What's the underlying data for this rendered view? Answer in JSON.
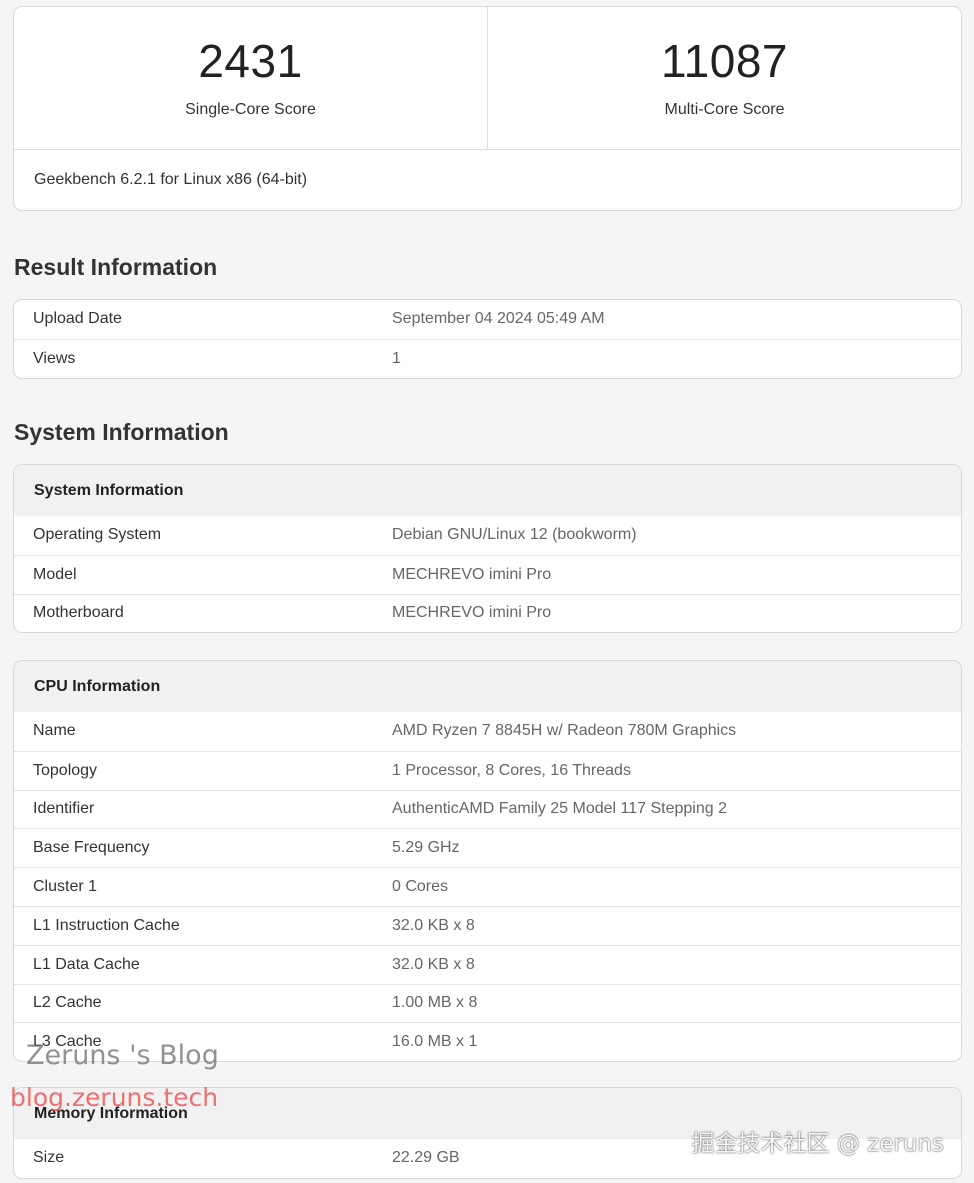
{
  "scores": {
    "single_value": "2431",
    "single_label": "Single-Core Score",
    "multi_value": "11087",
    "multi_label": "Multi-Core Score",
    "version": "Geekbench 6.2.1 for Linux x86 (64-bit)"
  },
  "result": {
    "heading": "Result Information",
    "rows": [
      {
        "key": "Upload Date",
        "value": "September 04 2024 05:49 AM"
      },
      {
        "key": "Views",
        "value": "1"
      }
    ]
  },
  "system": {
    "heading": "System Information",
    "table_title": "System Information",
    "rows": [
      {
        "key": "Operating System",
        "value": "Debian GNU/Linux 12 (bookworm)"
      },
      {
        "key": "Model",
        "value": "MECHREVO imini Pro"
      },
      {
        "key": "Motherboard",
        "value": "MECHREVO imini Pro"
      }
    ]
  },
  "cpu": {
    "table_title": "CPU Information",
    "rows": [
      {
        "key": "Name",
        "value": "AMD Ryzen 7 8845H w/ Radeon 780M Graphics"
      },
      {
        "key": "Topology",
        "value": "1 Processor, 8 Cores, 16 Threads"
      },
      {
        "key": "Identifier",
        "value": "AuthenticAMD Family 25 Model 117 Stepping 2"
      },
      {
        "key": "Base Frequency",
        "value": "5.29 GHz"
      },
      {
        "key": "Cluster 1",
        "value": "0 Cores"
      },
      {
        "key": "L1 Instruction Cache",
        "value": "32.0 KB x 8"
      },
      {
        "key": "L1 Data Cache",
        "value": "32.0 KB x 8"
      },
      {
        "key": "L2 Cache",
        "value": "1.00 MB x 8"
      },
      {
        "key": "L3 Cache",
        "value": "16.0 MB x 1"
      }
    ]
  },
  "memory": {
    "table_title": "Memory Information",
    "rows": [
      {
        "key": "Size",
        "value": "22.29 GB"
      }
    ]
  },
  "watermarks": {
    "blog_title": "Zeruns 's Blog",
    "blog_url": "blog.zeruns.tech",
    "juejin": "掘金技术社区 @ zeruns"
  }
}
